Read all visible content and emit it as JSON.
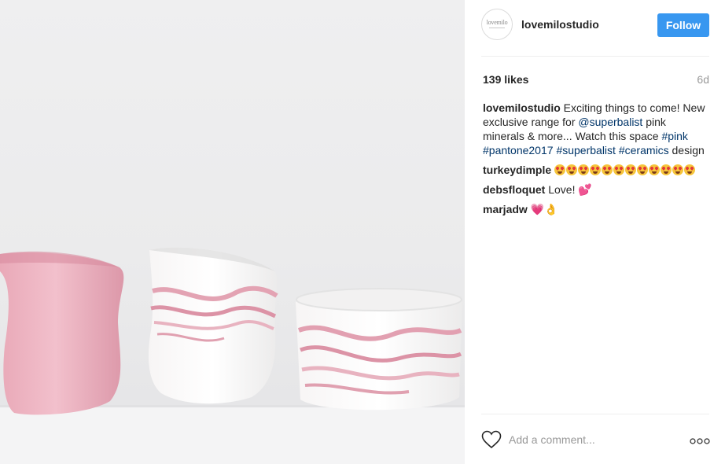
{
  "post": {
    "image": {
      "subject": "pink-ceramics-photo",
      "palette": {
        "background": "#eeeeef",
        "pink": "#e8a8b8",
        "marble": "#d68aa0",
        "white": "#f8f6f6"
      }
    }
  },
  "header": {
    "username": "lovemilostudio",
    "avatar_text": "lovemilo",
    "follow_label": "Follow"
  },
  "stats": {
    "likes": "139 likes",
    "age": "6d"
  },
  "caption": {
    "username": "lovemilostudio",
    "text_1": " Exciting things to come! New exclusive range for ",
    "mention": "@superbalist",
    "text_2": " pink minerals & more... Watch this space ",
    "tag_pink": "#pink",
    "tag_pantone": "#pantone2017",
    "tag_superbalist": "#superbalist",
    "tag_ceramics": "#ceramics",
    "text_3": " design"
  },
  "comments": [
    {
      "username": "turkeydimple",
      "text": "",
      "emoji": "heart-eyes-face",
      "emoji_count": 12
    },
    {
      "username": "debsfloquet",
      "text": "Love!",
      "emoji": "two-hearts"
    },
    {
      "username": "marjadw",
      "text": "",
      "emoji": "sparkling-heart-ok-hand"
    }
  ],
  "add_comment": {
    "placeholder": "Add a comment...",
    "like_icon": "heart-outline-icon",
    "more_icon": "more-options-icon"
  },
  "colors": {
    "accent": "#3897f0",
    "link": "#003569",
    "muted": "#999999",
    "divider": "#efefef"
  }
}
